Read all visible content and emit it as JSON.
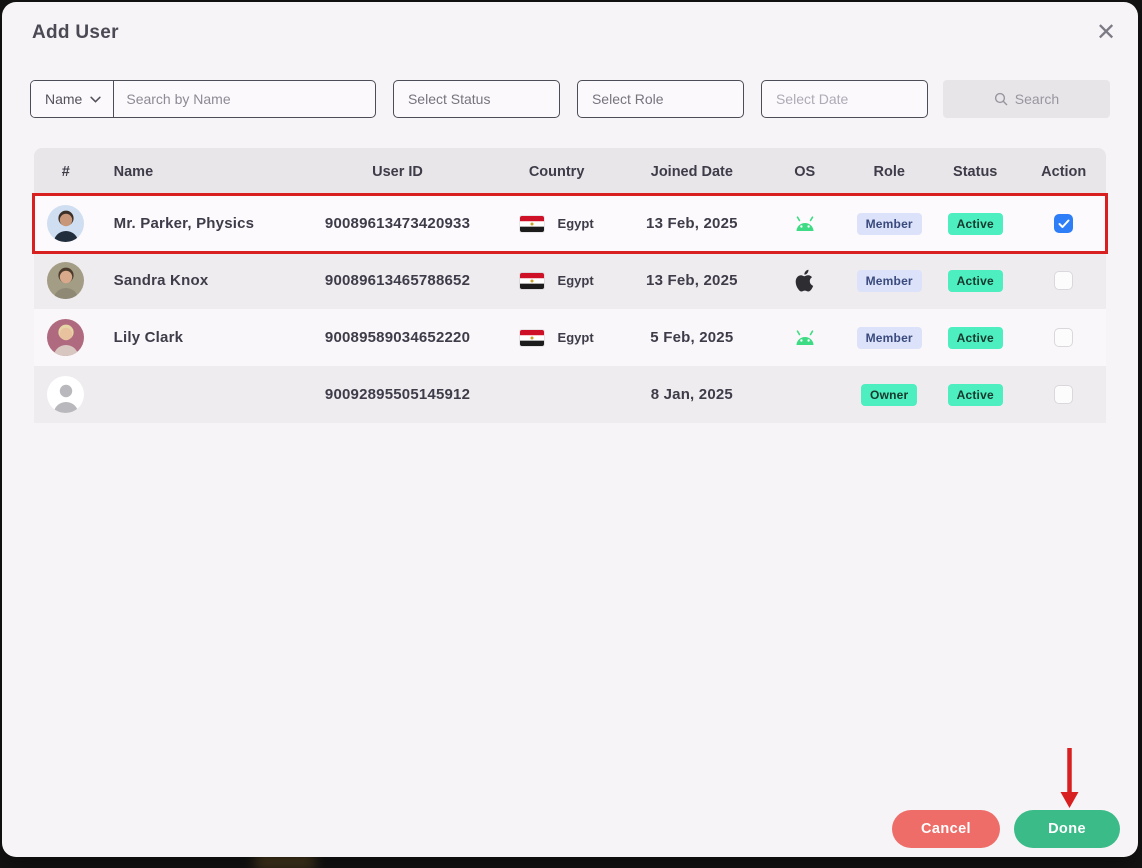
{
  "modal": {
    "title": "Add User",
    "close_icon": "✕"
  },
  "filters": {
    "name_dropdown_label": "Name",
    "search_placeholder": "Search by Name",
    "status_placeholder": "Select Status",
    "role_placeholder": "Select Role",
    "date_placeholder": "Select Date",
    "search_button_label": "Search"
  },
  "table": {
    "headers": [
      "#",
      "Name",
      "User ID",
      "Country",
      "Joined Date",
      "OS",
      "Role",
      "Status",
      "Action"
    ],
    "rows": [
      {
        "avatar": "man-suit",
        "name": "Mr. Parker, Physics",
        "user_id": "90089613473420933",
        "country": "Egypt",
        "joined_date": "13 Feb, 2025",
        "os": "android",
        "role": "Member",
        "status": "Active",
        "checked": true,
        "highlighted": true
      },
      {
        "avatar": "woman-olive",
        "name": "Sandra Knox",
        "user_id": "90089613465788652",
        "country": "Egypt",
        "joined_date": "13 Feb, 2025",
        "os": "apple",
        "role": "Member",
        "status": "Active",
        "checked": false,
        "highlighted": false
      },
      {
        "avatar": "woman-blonde",
        "name": "Lily Clark",
        "user_id": "90089589034652220",
        "country": "Egypt",
        "joined_date": "5 Feb, 2025",
        "os": "android",
        "role": "Member",
        "status": "Active",
        "checked": false,
        "highlighted": false
      },
      {
        "avatar": "placeholder",
        "name": "",
        "user_id": "90092895505145912",
        "country": "",
        "joined_date": "8 Jan, 2025",
        "os": "",
        "role": "Owner",
        "status": "Active",
        "checked": false,
        "highlighted": false
      }
    ]
  },
  "footer": {
    "cancel_label": "Cancel",
    "done_label": "Done"
  },
  "colors": {
    "accent_blue_checkbox": "#2d7ef7",
    "badge_member_bg": "#dbe2f9",
    "badge_mint_bg": "#4deec0",
    "cancel_red": "#ee6d68",
    "done_green": "#3bbb88",
    "annotation_red": "#d92020",
    "android_green": "#3ddc84"
  },
  "annotations": {
    "highlighted_row_name": "Mr. Parker, Physics",
    "arrow_points_to": "done-button"
  }
}
